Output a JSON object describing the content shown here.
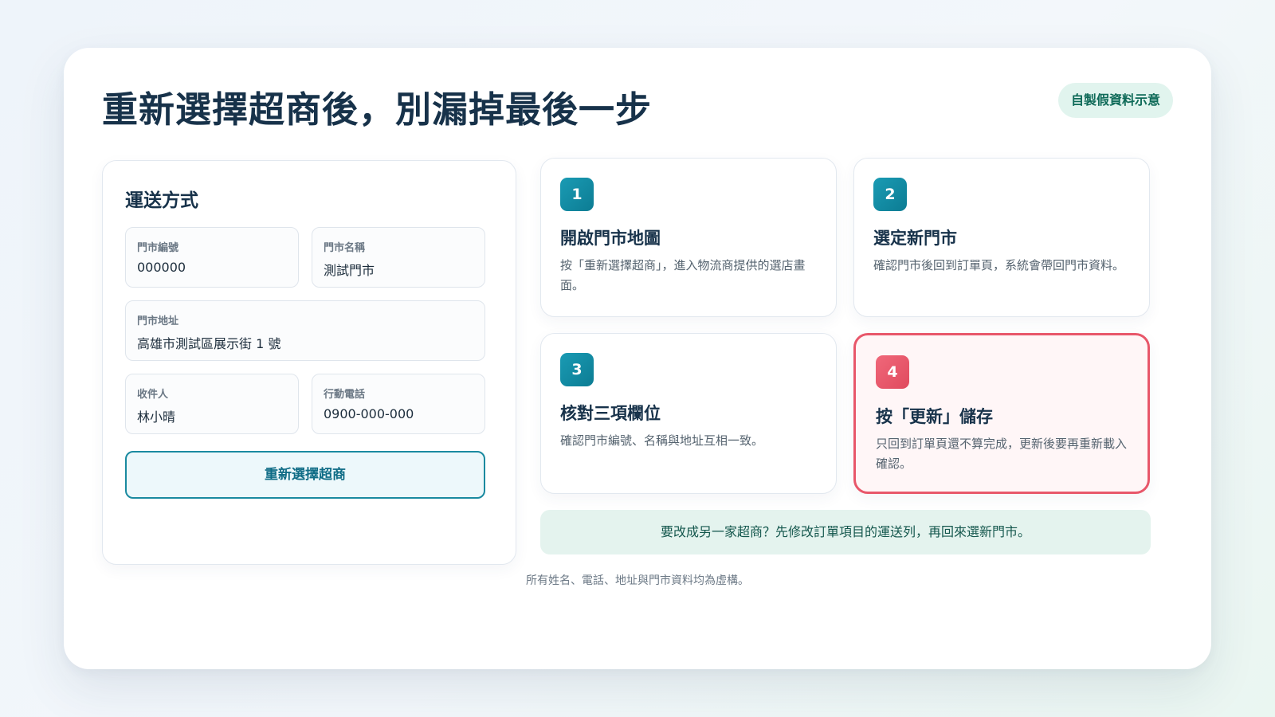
{
  "title": "重新選擇超商後，別漏掉最後一步",
  "badge": "自製假資料示意",
  "form": {
    "heading": "運送方式",
    "fields": {
      "store_id": {
        "label": "門市編號",
        "value": "000000"
      },
      "store_name": {
        "label": "門市名稱",
        "value": "測試門市"
      },
      "store_address": {
        "label": "門市地址",
        "value": "高雄市測試區展示街 1 號"
      },
      "recipient": {
        "label": "收件人",
        "value": "林小晴"
      },
      "phone": {
        "label": "行動電話",
        "value": "0900-000-000"
      }
    },
    "reselect_button": "重新選擇超商"
  },
  "steps": [
    {
      "number": "1",
      "title": "開啟門市地圖",
      "description": "按「重新選擇超商」，進入物流商提供的選店畫面。"
    },
    {
      "number": "2",
      "title": "選定新門市",
      "description": "確認門市後回到訂單頁，系統會帶回門市資料。"
    },
    {
      "number": "3",
      "title": "核對三項欄位",
      "description": "確認門市編號、名稱與地址互相一致。"
    },
    {
      "number": "4",
      "title": "按「更新」儲存",
      "description": "只回到訂單頁還不算完成，更新後要再重新載入確認。"
    }
  ],
  "note": "要改成另一家超商？先修改訂單項目的運送列，再回來選新門市。",
  "footnote": "所有姓名、電話、地址與門市資料均為虛構。",
  "colors": {
    "accent_teal": "#1a8aa0",
    "highlight_red": "#e8576a",
    "badge_green": "#0e6a58"
  }
}
